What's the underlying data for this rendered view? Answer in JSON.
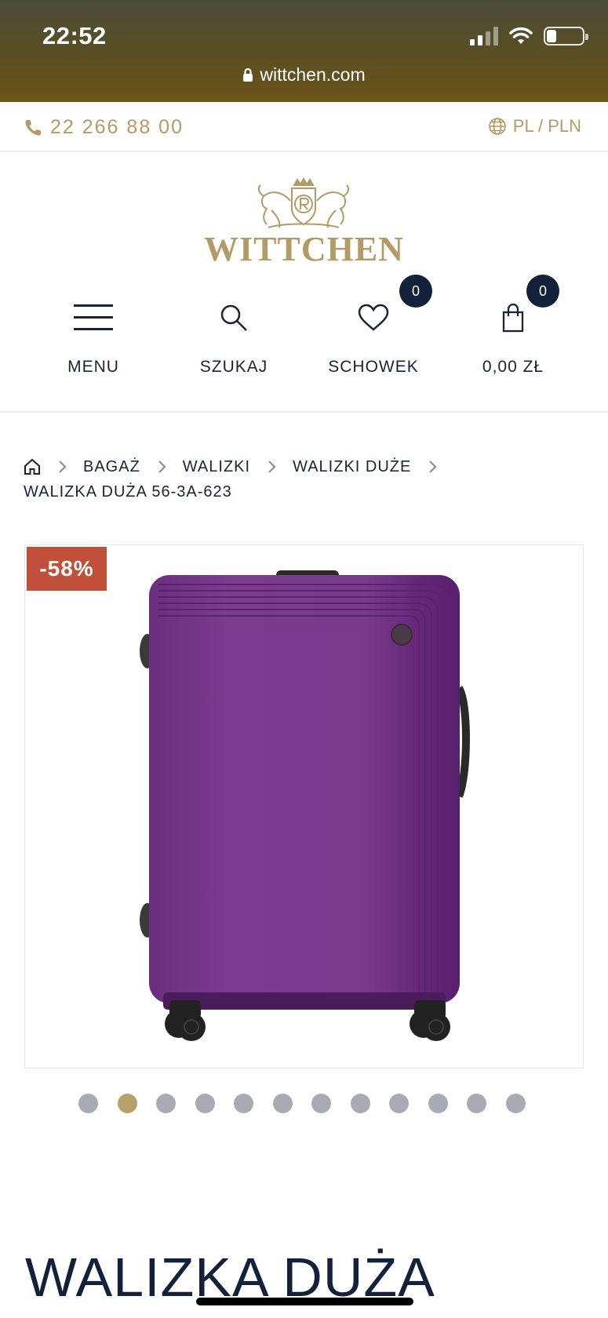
{
  "status_bar": {
    "time": "22:52"
  },
  "browser": {
    "url": "wittchen.com"
  },
  "utility_bar": {
    "phone": "22 266 88 00",
    "locale": "PL / PLN"
  },
  "brand": {
    "name": "WITTCHEN",
    "color": "#b39a66"
  },
  "nav": {
    "menu_label": "MENU",
    "search_label": "SZUKAJ",
    "wishlist_label": "SCHOWEK",
    "wishlist_count": "0",
    "cart_label": "0,00 ZŁ",
    "cart_count": "0"
  },
  "breadcrumb": {
    "items": [
      "BAGAŻ",
      "WALIZKI",
      "WALIZKI DUŻE"
    ],
    "current": "WALIZKA DUŻA 56-3A-623"
  },
  "product": {
    "discount": "-58%",
    "title": "WALIZKA DUŻA",
    "image_color": "#7a3a8c",
    "gallery": {
      "total_slides": 12,
      "active_slide": 2
    }
  },
  "colors": {
    "accent_gold": "#b39a66",
    "navy": "#14213a",
    "discount_red": "#c1503a"
  }
}
